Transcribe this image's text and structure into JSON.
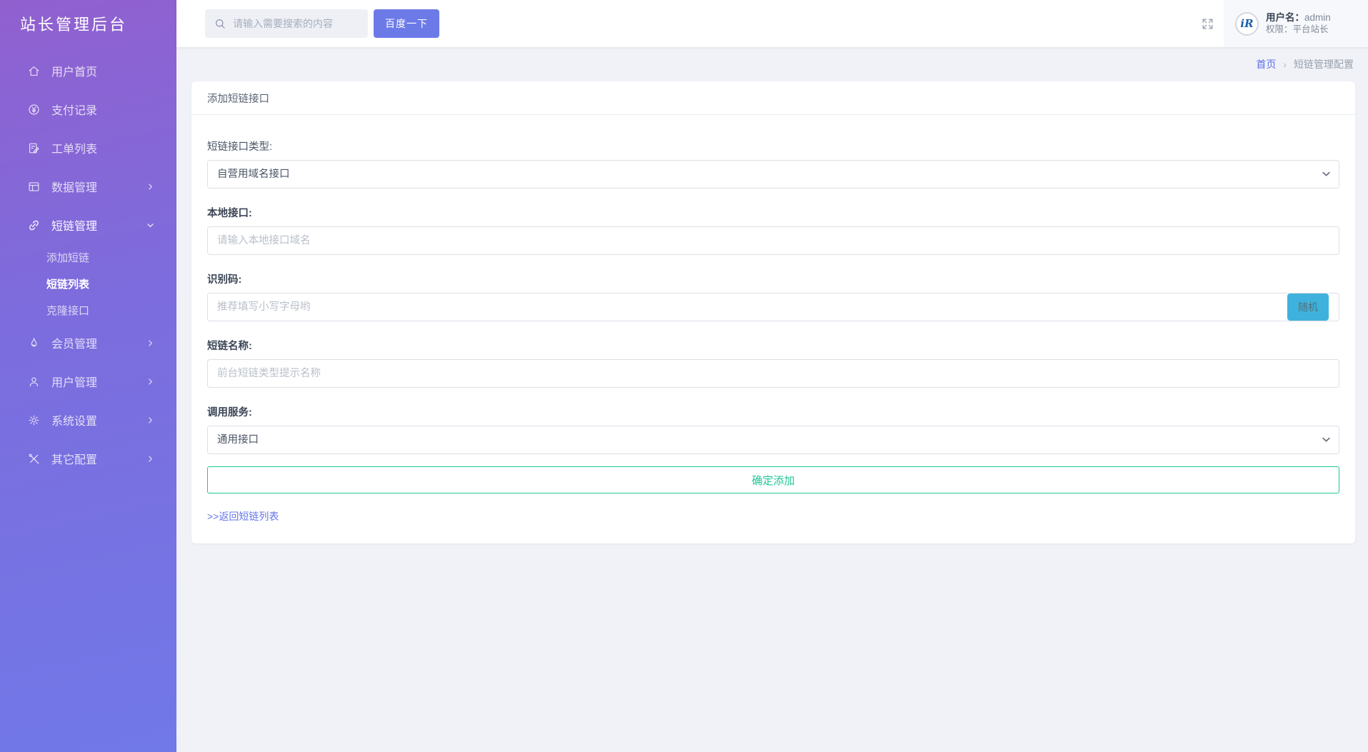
{
  "sidebar": {
    "title": "站长管理后台",
    "items": [
      {
        "label": "用户首页",
        "icon": "home-icon"
      },
      {
        "label": "支付记录",
        "icon": "yen-circle-icon"
      },
      {
        "label": "工单列表",
        "icon": "ticket-icon"
      },
      {
        "label": "数据管理",
        "icon": "data-icon",
        "chevron": "right"
      },
      {
        "label": "短链管理",
        "icon": "link-icon",
        "chevron": "down",
        "expanded": true
      },
      {
        "label": "会员管理",
        "icon": "flame-icon",
        "chevron": "right"
      },
      {
        "label": "用户管理",
        "icon": "user-icon",
        "chevron": "right"
      },
      {
        "label": "系统设置",
        "icon": "gear-icon",
        "chevron": "right"
      },
      {
        "label": "其它配置",
        "icon": "tools-icon",
        "chevron": "right"
      }
    ],
    "submenu": [
      {
        "label": "添加短链",
        "active": false
      },
      {
        "label": "短链列表",
        "active": true
      },
      {
        "label": "克隆接口",
        "active": false
      }
    ]
  },
  "topbar": {
    "search_placeholder": "请输入需要搜索的内容",
    "search_button": "百度一下",
    "user": {
      "avatar_text": "iR",
      "name_label": "用户名：",
      "name": "admin",
      "role_label": "权限：",
      "role": "平台站长"
    }
  },
  "breadcrumb": {
    "home": "首页",
    "separator": "›",
    "current": "短链管理配置"
  },
  "form": {
    "card_title": "添加短链接口",
    "type_label": "短链接口类型:",
    "type_value": "自营用域名接口",
    "local_label": "本地接口:",
    "local_placeholder": "请输入本地接口域名",
    "code_label": "识别码:",
    "code_placeholder": "推荐填写小写字母哟",
    "random_button": "随机",
    "name_label": "短链名称:",
    "name_placeholder": "前台短链类型提示名称",
    "service_label": "调用服务:",
    "service_value": "通用接口",
    "submit_button": "确定添加",
    "back_link": ">>返回短链列表"
  },
  "colors": {
    "sidebar_gradient_top": "#9160cf",
    "sidebar_gradient_bottom": "#7178e8",
    "accent_button": "#6c7ae8",
    "random_button_bg": "#3eb2dc",
    "submit_green": "#1dc796",
    "breadcrumb_link": "#5f6ee8",
    "page_background": "#f0f2f7"
  }
}
